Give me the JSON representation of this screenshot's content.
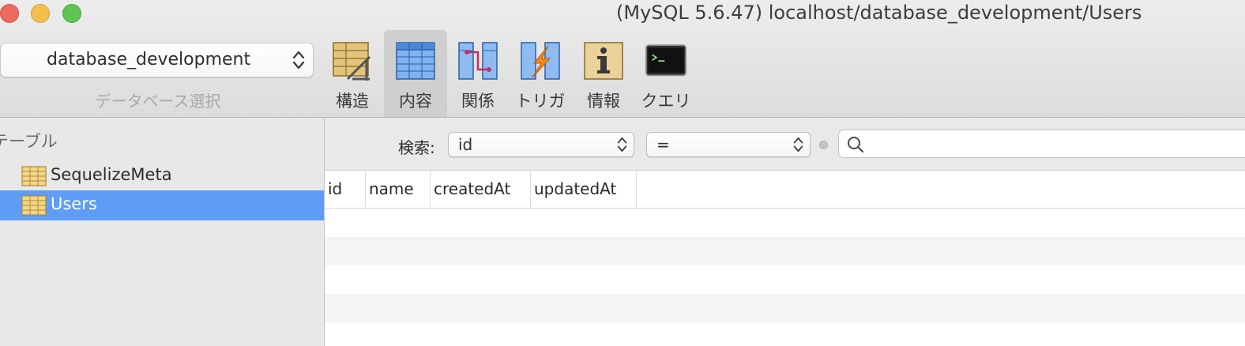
{
  "window": {
    "title": "(MySQL 5.6.47) localhost/database_development/Users"
  },
  "toolbar": {
    "database_selector": {
      "value": "database_development",
      "caption": "データベース選択"
    },
    "buttons": [
      {
        "label": "構造",
        "icon": "structure-icon",
        "active": false
      },
      {
        "label": "内容",
        "icon": "content-table-icon",
        "active": true
      },
      {
        "label": "関係",
        "icon": "relations-icon",
        "active": false
      },
      {
        "label": "トリガ",
        "icon": "triggers-icon",
        "active": false
      },
      {
        "label": "情報",
        "icon": "info-icon",
        "active": false
      },
      {
        "label": "クエリ",
        "icon": "terminal-query-icon",
        "active": false
      }
    ]
  },
  "sidebar": {
    "header": "テーブル",
    "tables": [
      {
        "label": "SequelizeMeta",
        "selected": false
      },
      {
        "label": "Users",
        "selected": true
      }
    ]
  },
  "filter": {
    "label": "検索:",
    "field": "id",
    "operator": "=",
    "search_value": ""
  },
  "grid": {
    "columns": [
      "id",
      "name",
      "createdAt",
      "updatedAt"
    ],
    "rows": []
  },
  "colors": {
    "selection": "#5e9cf5",
    "close": "#ed6a5e",
    "minimize": "#f5bf4f",
    "maximize": "#61c554"
  }
}
